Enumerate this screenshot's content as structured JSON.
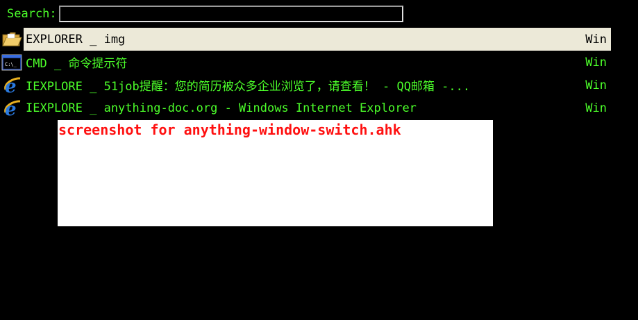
{
  "search": {
    "label": "Search:",
    "value": "",
    "placeholder": ""
  },
  "windows": [
    {
      "icon": "folder-icon",
      "title": "EXPLORER _ img",
      "type": "Win",
      "selected": true
    },
    {
      "icon": "cmd-icon",
      "title": "CMD _ 命令提示符",
      "type": "Win",
      "selected": false
    },
    {
      "icon": "internet-explorer-icon",
      "title": "IEXPLORE _ 51job提醒：您的简历被众多企业浏览了，请查看！ - QQ邮箱 -...",
      "type": "Win",
      "selected": false
    },
    {
      "icon": "internet-explorer-icon",
      "title": "IEXPLORE _ anything-doc.org - Windows Internet Explorer",
      "type": "Win",
      "selected": false
    }
  ],
  "caption": {
    "text": "screenshot for anything-window-switch.ahk"
  },
  "colors": {
    "background": "#000000",
    "text": "#4cff2a",
    "selected_background": "#ece9d8",
    "caption_text": "#ff1010",
    "caption_background": "#ffffff"
  }
}
